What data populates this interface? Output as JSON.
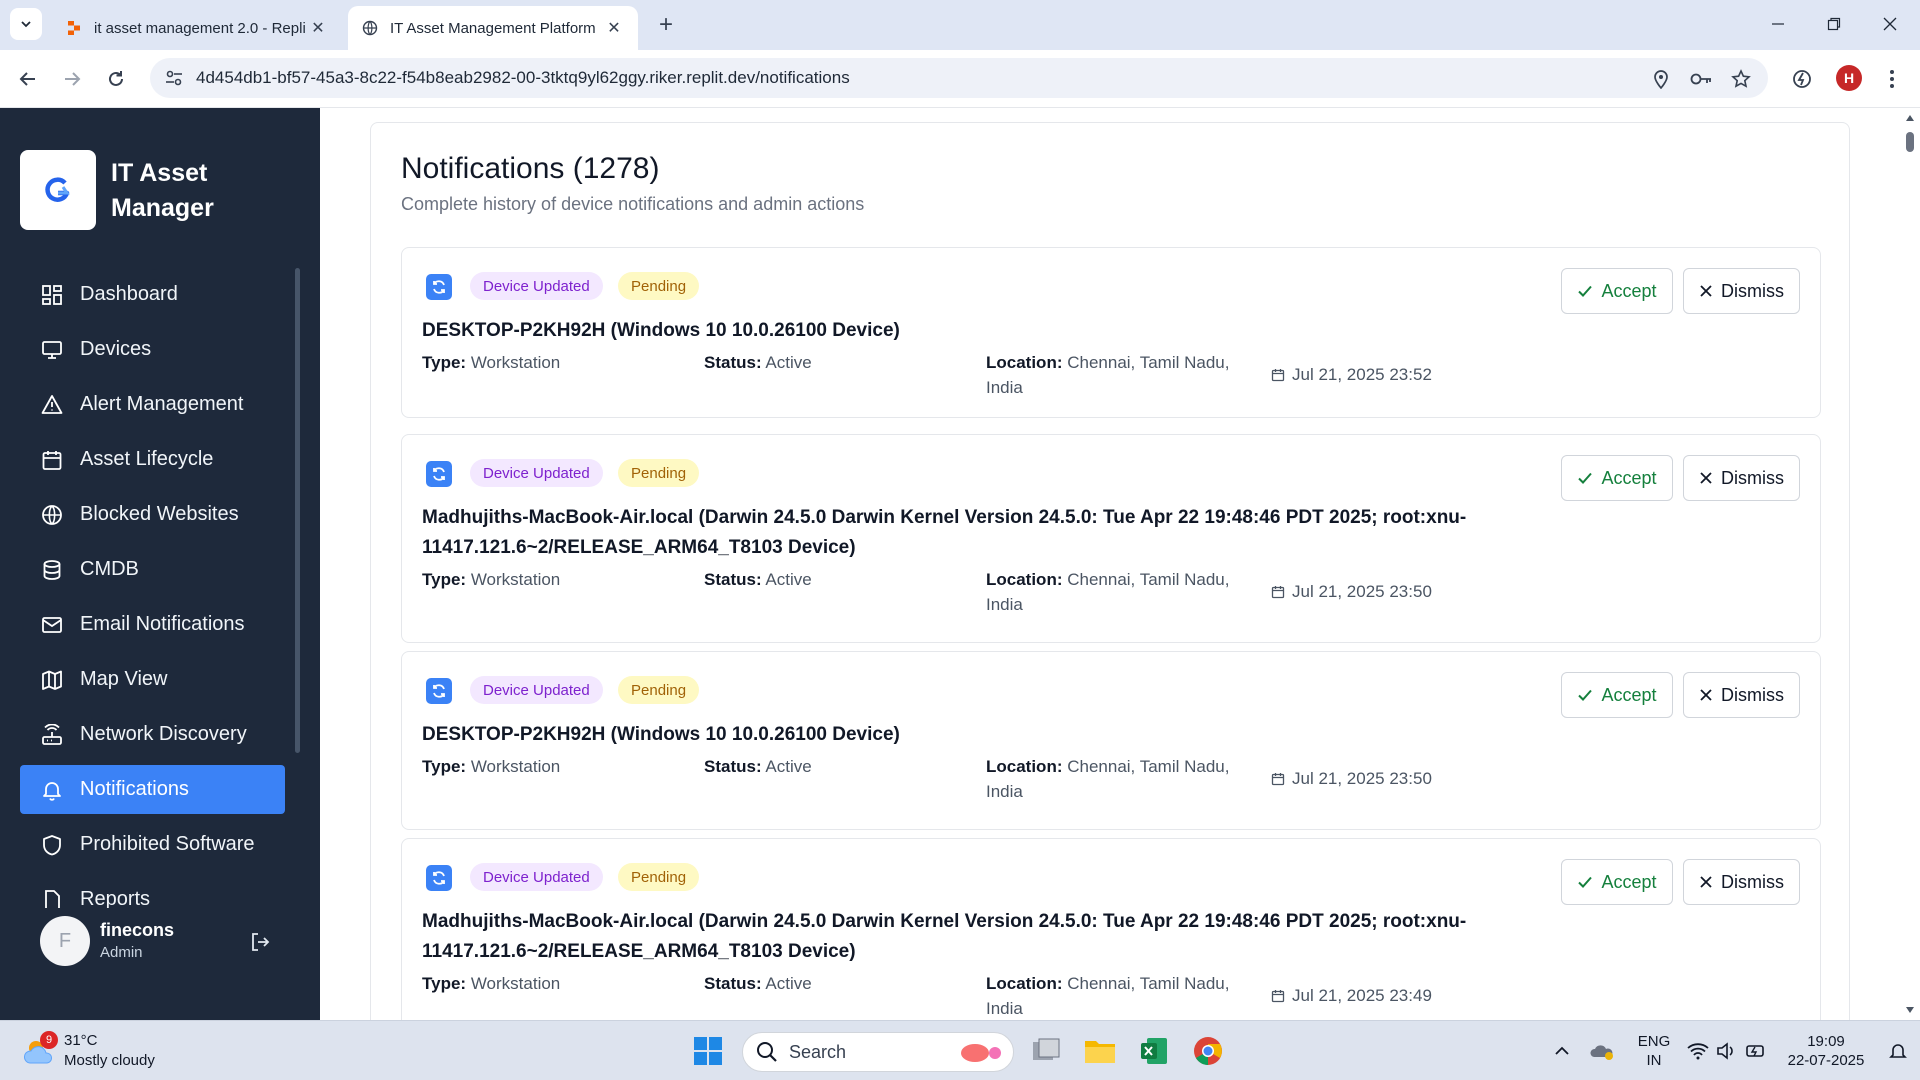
{
  "browser": {
    "tabs": [
      {
        "title": "it asset management 2.0 - Repli",
        "active": false
      },
      {
        "title": "IT Asset Management Platform",
        "active": true
      }
    ],
    "url_host": "4d454db1-bf57-45a3-8c22-f54b8eab2982-00-3tktq9yl62ggy.riker.replit.dev",
    "url_path": "/notifications",
    "profile_initial": "H"
  },
  "sidebar": {
    "brand_name": "IT Asset Manager",
    "items": [
      {
        "label": "Dashboard",
        "icon": "dashboard-icon",
        "active": false
      },
      {
        "label": "Devices",
        "icon": "monitor-icon",
        "active": false
      },
      {
        "label": "Alert Management",
        "icon": "alert-triangle-icon",
        "active": false
      },
      {
        "label": "Asset Lifecycle",
        "icon": "calendar-icon",
        "active": false
      },
      {
        "label": "Blocked Websites",
        "icon": "globe-icon",
        "active": false
      },
      {
        "label": "CMDB",
        "icon": "database-icon",
        "active": false
      },
      {
        "label": "Email Notifications",
        "icon": "mail-icon",
        "active": false
      },
      {
        "label": "Map View",
        "icon": "map-icon",
        "active": false
      },
      {
        "label": "Network Discovery",
        "icon": "router-icon",
        "active": false
      },
      {
        "label": "Notifications",
        "icon": "bell-icon",
        "active": true
      },
      {
        "label": "Prohibited Software",
        "icon": "shield-icon",
        "active": false
      },
      {
        "label": "Reports",
        "icon": "file-icon",
        "active": false
      }
    ],
    "user": {
      "initial": "F",
      "name": "finecons",
      "role": "Admin"
    }
  },
  "page": {
    "title": "Notifications (1278)",
    "subtitle": "Complete history of device notifications and admin actions"
  },
  "labels": {
    "type": "Type:",
    "status": "Status:",
    "location": "Location:",
    "accept": "Accept",
    "dismiss": "Dismiss"
  },
  "notifications": [
    {
      "badge_type": "Device Updated",
      "badge_status": "Pending",
      "title": "DESKTOP-P2KH92H (Windows 10 10.0.26100 Device)",
      "type": "Workstation",
      "status": "Active",
      "location": "Chennai, Tamil Nadu, India",
      "date": "Jul 21, 2025 23:52"
    },
    {
      "badge_type": "Device Updated",
      "badge_status": "Pending",
      "title": "Madhujiths-MacBook-Air.local (Darwin 24.5.0 Darwin Kernel Version 24.5.0: Tue Apr 22 19:48:46 PDT 2025; root:xnu-11417.121.6~2/RELEASE_ARM64_T8103 Device)",
      "type": "Workstation",
      "status": "Active",
      "location": "Chennai, Tamil Nadu, India",
      "date": "Jul 21, 2025 23:50"
    },
    {
      "badge_type": "Device Updated",
      "badge_status": "Pending",
      "title": "DESKTOP-P2KH92H (Windows 10 10.0.26100 Device)",
      "type": "Workstation",
      "status": "Active",
      "location": "Chennai, Tamil Nadu, India",
      "date": "Jul 21, 2025 23:50"
    },
    {
      "badge_type": "Device Updated",
      "badge_status": "Pending",
      "title": "Madhujiths-MacBook-Air.local (Darwin 24.5.0 Darwin Kernel Version 24.5.0: Tue Apr 22 19:48:46 PDT 2025; root:xnu-11417.121.6~2/RELEASE_ARM64_T8103 Device)",
      "type": "Workstation",
      "status": "Active",
      "location": "Chennai, Tamil Nadu, India",
      "date": "Jul 21, 2025 23:49"
    }
  ],
  "taskbar": {
    "weather_badge": "9",
    "temperature": "31°C",
    "condition": "Mostly cloudy",
    "search_placeholder": "Search",
    "language": "ENG",
    "region": "IN",
    "time": "19:09",
    "date": "22-07-2025"
  },
  "colors": {
    "sidebar_bg": "#1e293b",
    "accent": "#3b82f6",
    "accept_green": "#15803d",
    "badge_type_bg": "#f3e8ff",
    "badge_status_bg": "#fef9c3"
  }
}
